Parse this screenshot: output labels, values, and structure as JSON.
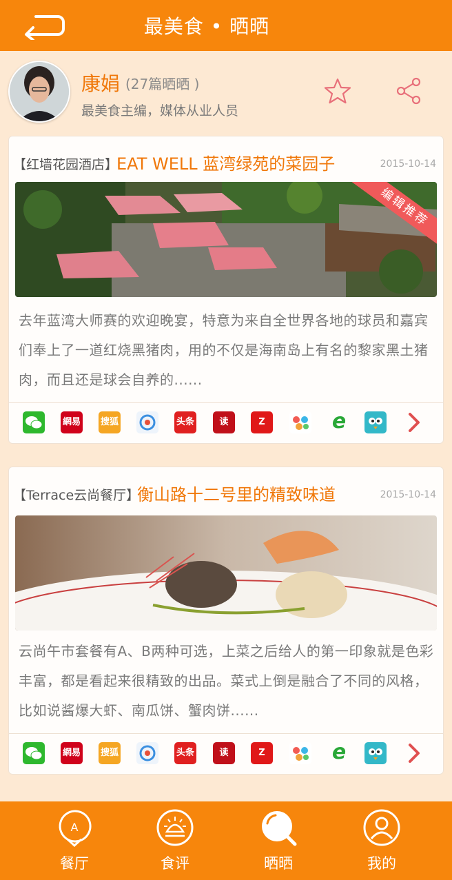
{
  "header": {
    "title": "最美食 • 晒晒"
  },
  "profile": {
    "name": "康娟",
    "count": "(27篇晒晒 )",
    "desc": "最美食主编，媒体从业人员"
  },
  "posts": [
    {
      "restaurant": "【红墙花园酒店】",
      "title": "EAT WELL 蓝湾绿苑的菜园子",
      "date": "2015-10-14",
      "badge": "编辑推荐",
      "excerpt": "去年蓝湾大师赛的欢迎晚宴，特意为来自全世界各地的球员和嘉宾们奉上了一道红烧黑猪肉，用的不仅是海南岛上有名的黎家黑土猪肉，而且还是球会自养的......"
    },
    {
      "restaurant": "【Terrace云尚餐厅】",
      "title": "衡山路十二号里的精致味道",
      "date": "2015-10-14",
      "excerpt": "云尚午市套餐有A、B两种可选，上菜之后给人的第一印象就是色彩丰富，都是看起来很精致的出品。菜式上倒是融合了不同的风格，比如说酱爆大虾、南瓜饼、蟹肉饼......"
    }
  ],
  "share_icons": [
    {
      "name": "wechat-icon",
      "label": "",
      "color": "#2eb82e"
    },
    {
      "name": "netease-icon",
      "label": "網易",
      "color": "#d0021b"
    },
    {
      "name": "sohu-icon",
      "label": "搜狐",
      "color": "#f5a623"
    },
    {
      "name": "qq-news-icon",
      "label": "",
      "color": "#3b8fe0"
    },
    {
      "name": "toutiao-icon",
      "label": "头条",
      "color": "#e02020"
    },
    {
      "name": "du-icon",
      "label": "读",
      "color": "#c0101a"
    },
    {
      "name": "zaker-icon",
      "label": "Z",
      "color": "#e01818"
    },
    {
      "name": "dots-icon",
      "label": "",
      "color": "#ffffff"
    },
    {
      "name": "ie-icon",
      "label": "e",
      "color": "#2aa838"
    },
    {
      "name": "bird-icon",
      "label": "",
      "color": "#33b8c8"
    }
  ],
  "tabs": [
    {
      "label": "餐厅",
      "icon": "restaurant-icon"
    },
    {
      "label": "食评",
      "icon": "review-icon"
    },
    {
      "label": "晒晒",
      "icon": "share-food-icon"
    },
    {
      "label": "我的",
      "icon": "profile-icon"
    }
  ],
  "colors": {
    "accent": "#f7860c",
    "title": "#f0780a",
    "background": "#fde9d3"
  }
}
